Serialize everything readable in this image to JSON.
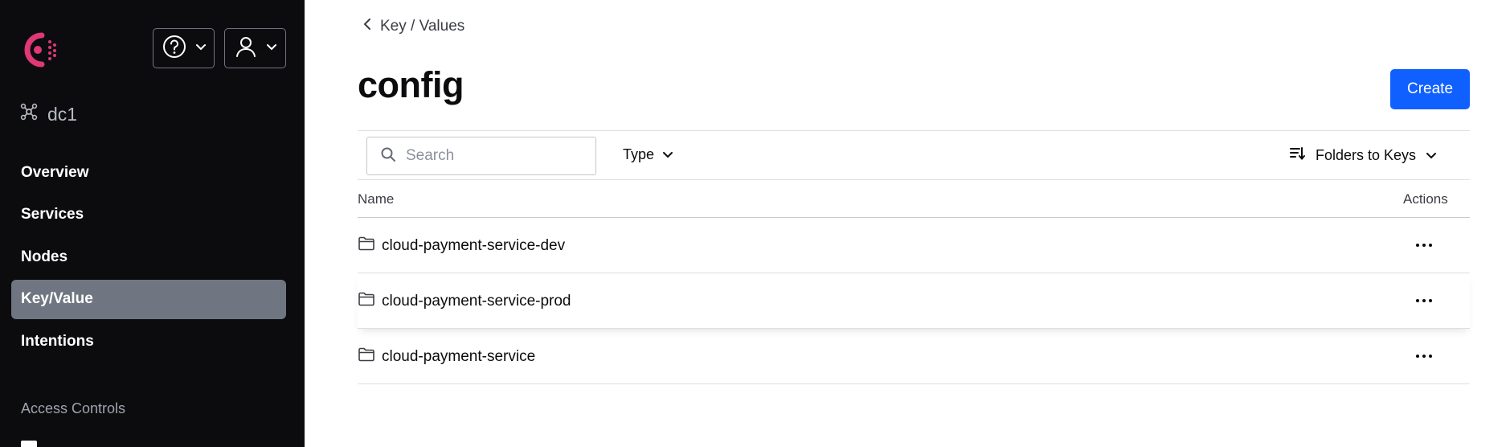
{
  "colors": {
    "sidebar_bg": "#0c0c0e",
    "active_nav": "#6f7682",
    "brand": "#e03875",
    "primary": "#1060ff"
  },
  "header": {
    "help_icon": "help-circle-icon",
    "user_icon": "user-icon"
  },
  "datacenter": {
    "label": "dc1",
    "icon": "datacenter-icon"
  },
  "nav": {
    "items": [
      {
        "label": "Overview",
        "active": false
      },
      {
        "label": "Services",
        "active": false
      },
      {
        "label": "Nodes",
        "active": false
      },
      {
        "label": "Key/Value",
        "active": true
      },
      {
        "label": "Intentions",
        "active": false
      }
    ],
    "section_label": "Access Controls"
  },
  "breadcrumb": {
    "label": "Key / Values"
  },
  "page": {
    "title": "config",
    "create_label": "Create"
  },
  "toolbar": {
    "search_placeholder": "Search",
    "type_label": "Type",
    "sort_label": "Folders to Keys"
  },
  "table": {
    "columns": {
      "name": "Name",
      "actions": "Actions"
    },
    "rows": [
      {
        "name": "cloud-payment-service-dev"
      },
      {
        "name": "cloud-payment-service-prod"
      },
      {
        "name": "cloud-payment-service"
      }
    ]
  }
}
